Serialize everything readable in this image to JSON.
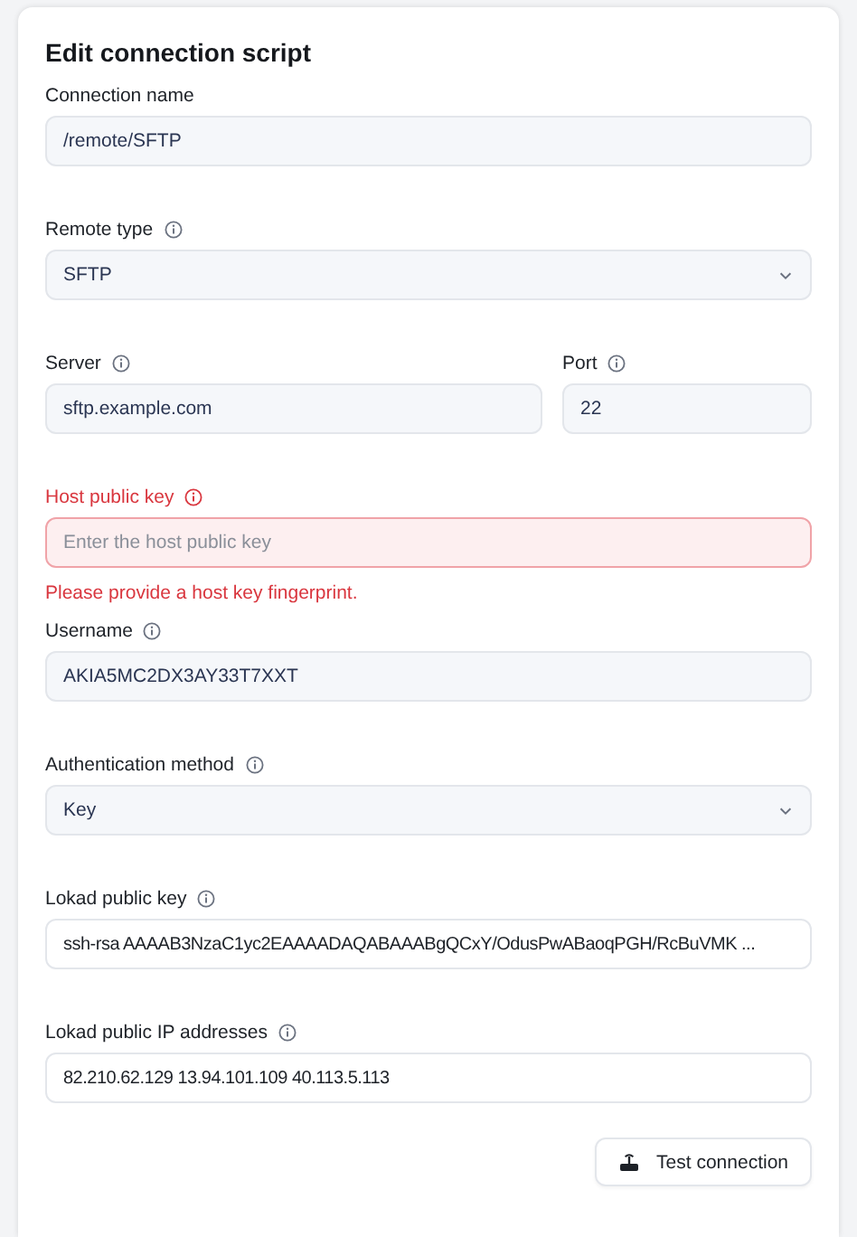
{
  "title": "Edit connection script",
  "rows": [
    [
      {
        "label": "Connection name",
        "info": false,
        "kind": "text",
        "value": "/remote/SFTP",
        "invalid": false,
        "readonly": false
      }
    ],
    [
      {
        "label": "Remote type",
        "info": true,
        "kind": "select",
        "value": "SFTP",
        "invalid": false,
        "readonly": false
      }
    ],
    [
      {
        "label": "Server",
        "info": true,
        "kind": "text",
        "value": "sftp.example.com",
        "invalid": false,
        "readonly": false
      },
      {
        "label": "Port",
        "info": true,
        "kind": "text",
        "value": "22",
        "invalid": false,
        "readonly": false
      }
    ],
    [
      {
        "label": "Host public key",
        "info": true,
        "kind": "text",
        "placeholder": "Enter the host public key",
        "invalid": true,
        "readonly": false,
        "error": "Please provide a host key fingerprint."
      }
    ],
    [
      {
        "label": "Username",
        "info": true,
        "kind": "text",
        "value": "AKIA5MC2DX3AY33T7XXT",
        "invalid": false,
        "readonly": false
      }
    ],
    [
      {
        "label": "Authentication method",
        "info": true,
        "kind": "select",
        "value": "Key",
        "invalid": false,
        "readonly": false
      }
    ],
    [
      {
        "label": "Lokad public key",
        "info": true,
        "kind": "text",
        "value": "ssh-rsa AAAAB3NzaC1yc2EAAAADAQABAAABgQCxY/OdusPwABaoqPGH/RcBuVMK ...",
        "invalid": false,
        "readonly": true
      }
    ],
    [
      {
        "label": "Lokad public IP addresses",
        "info": true,
        "kind": "text",
        "value": "82.210.62.129 13.94.101.109 40.113.5.113",
        "invalid": false,
        "readonly": true
      }
    ]
  ],
  "button": {
    "label": "Test connection"
  }
}
